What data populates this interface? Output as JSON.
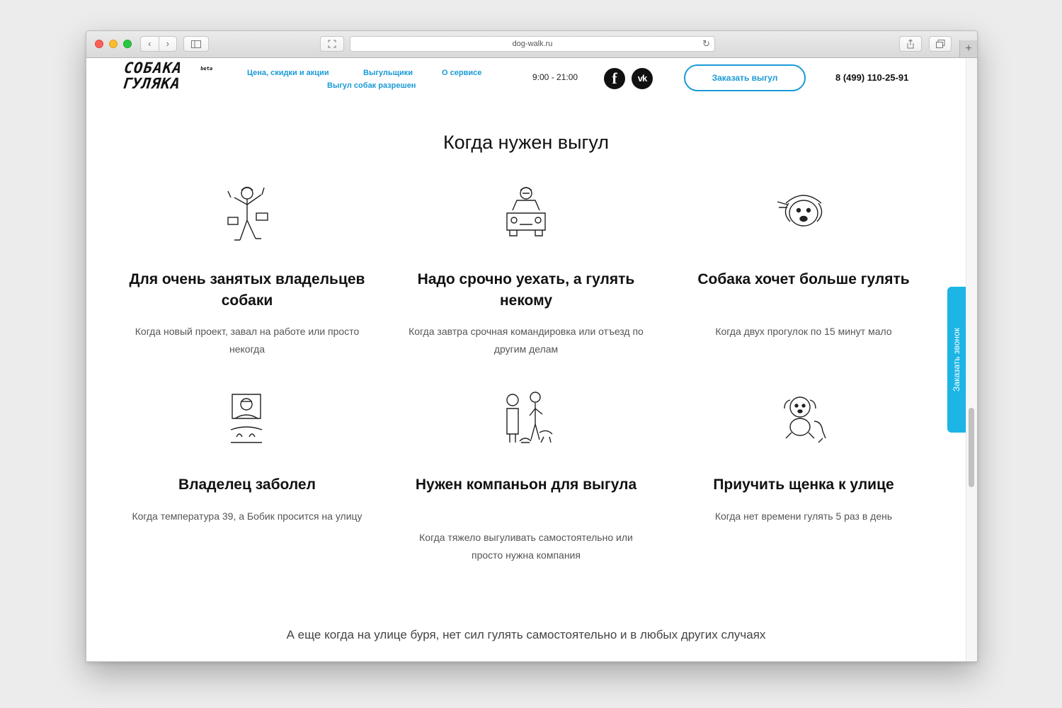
{
  "browser": {
    "url": "dog-walk.ru"
  },
  "header": {
    "logo_line1": "СОБАКА",
    "logo_line2": "ГУЛЯКА",
    "logo_badge": "beta",
    "nav": [
      {
        "label": "Цена, скидки и акции"
      },
      {
        "label": "Выгульщики"
      },
      {
        "label": "О сервисе"
      },
      {
        "label": "Выгул собак разрешен"
      }
    ],
    "hours": "9:00 - 21:00",
    "social": {
      "facebook": "f",
      "vk": "vk"
    },
    "order_button": "Заказать выгул",
    "phone": "8 (499) 110-25-91"
  },
  "section": {
    "title": "Когда нужен выгул",
    "cards": [
      {
        "title": "Для очень занятых владельцев собаки",
        "text": "Когда новый проект, завал на работе или просто некогда",
        "icon": "busy-person-icon"
      },
      {
        "title": "Надо срочно уехать, а гулять некому",
        "text": "Когда завтра срочная командировка или отъезд по другим делам",
        "icon": "car-driver-icon"
      },
      {
        "title": "Собака хочет больше гулять",
        "text": "Когда двух прогулок по 15 минут мало",
        "icon": "dog-head-icon"
      },
      {
        "title": "Владелец заболел",
        "text": "Когда температура 39, а Бобик просится на улицу",
        "icon": "sick-person-icon"
      },
      {
        "title": "Нужен компаньон для выгула",
        "text": "Когда тяжело выгуливать самостоятельно или просто нужна компания",
        "icon": "companion-walk-icon"
      },
      {
        "title": "Приучить щенка к улице",
        "text": "Когда нет времени гулять 5 раз в день",
        "icon": "puppy-icon"
      }
    ],
    "footer_note": "А еще когда на улице буря, нет сил гулять самостоятельно и в любых других случаях"
  },
  "callback_tab": "Заказать звонок",
  "colors": {
    "accent": "#1a9ad6",
    "callback": "#1cb5e6"
  }
}
